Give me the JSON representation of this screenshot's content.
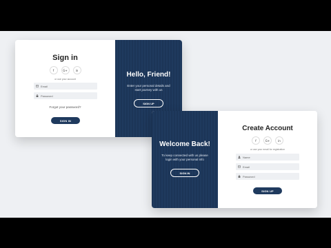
{
  "signin_card": {
    "title": "Sign in",
    "social": [
      {
        "glyph": "f",
        "icon": "facebook-icon"
      },
      {
        "glyph": "G+",
        "icon": "google-plus-icon"
      },
      {
        "glyph": "in",
        "icon": "linkedin-icon"
      }
    ],
    "note": "or use your account",
    "email_placeholder": "Email",
    "password_placeholder": "Password",
    "forgot_link": "Forgot your password?",
    "signin_button": "SIGN IN",
    "panel": {
      "title": "Hello, Friend!",
      "text_line1": "Enter your personal details and",
      "text_line2": "start journey with us",
      "button": "SIGN UP"
    }
  },
  "signup_card": {
    "panel": {
      "title": "Welcome Back!",
      "text_line1": "To keep connected with us please",
      "text_line2": "login with your personal info",
      "button": "SIGN IN"
    },
    "title": "Create Account",
    "social": [
      {
        "glyph": "f",
        "icon": "facebook-icon"
      },
      {
        "glyph": "G+",
        "icon": "google-plus-icon"
      },
      {
        "glyph": "in",
        "icon": "linkedin-icon"
      }
    ],
    "note": "or use your email for registration",
    "name_placeholder": "Name",
    "email_placeholder": "Email",
    "password_placeholder": "Password",
    "signup_button": "SIGN UP"
  },
  "colors": {
    "primary": "#1f3a5e",
    "field_bg": "#eef0f3",
    "page_bg": "#eef0f3"
  }
}
